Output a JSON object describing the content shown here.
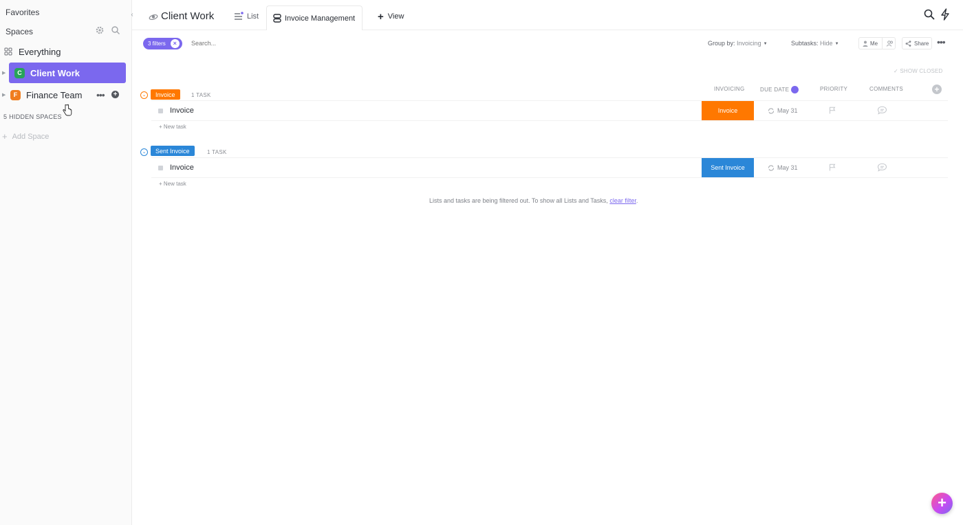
{
  "sidebar": {
    "favorites": "Favorites",
    "spaces": "Spaces",
    "everything": "Everything",
    "items": [
      {
        "label": "Client Work",
        "badge": "C",
        "color": "#27a35a",
        "active": true
      },
      {
        "label": "Finance Team",
        "badge": "F",
        "color": "#f07d1e",
        "active": false
      }
    ],
    "hidden_spaces": "5 HIDDEN SPACES",
    "add_space": "Add Space"
  },
  "header": {
    "breadcrumb": "Client Work",
    "tabs": [
      {
        "label": "List"
      },
      {
        "label": "Invoice Management",
        "active": true
      }
    ],
    "add_view": "View"
  },
  "toolbar": {
    "filters_chip": "3 filters",
    "search_placeholder": "Search...",
    "group_by_label": "Group by:",
    "group_by_value": "Invoicing",
    "subtasks_label": "Subtasks:",
    "subtasks_value": "Hide",
    "me": "Me",
    "share": "Share"
  },
  "list": {
    "show_closed": "SHOW CLOSED",
    "columns": [
      "INVOICING",
      "DUE DATE",
      "PRIORITY",
      "COMMENTS"
    ],
    "groups": [
      {
        "tag": "Invoice",
        "color": "#ff7800",
        "count": "1 TASK",
        "tasks": [
          {
            "name": "Invoice",
            "status": "Invoice",
            "due": "May 31"
          }
        ],
        "new_task": "+ New task"
      },
      {
        "tag": "Sent Invoice",
        "color": "#2b87d8",
        "count": "1 TASK",
        "tasks": [
          {
            "name": "Invoice",
            "status": "Sent Invoice",
            "due": "May 31"
          }
        ],
        "new_task": "+ New task"
      }
    ],
    "filter_message": "Lists and tasks are being filtered out. To show all Lists and Tasks,",
    "clear_filter": "clear filter"
  },
  "accent": "#7b68ee"
}
